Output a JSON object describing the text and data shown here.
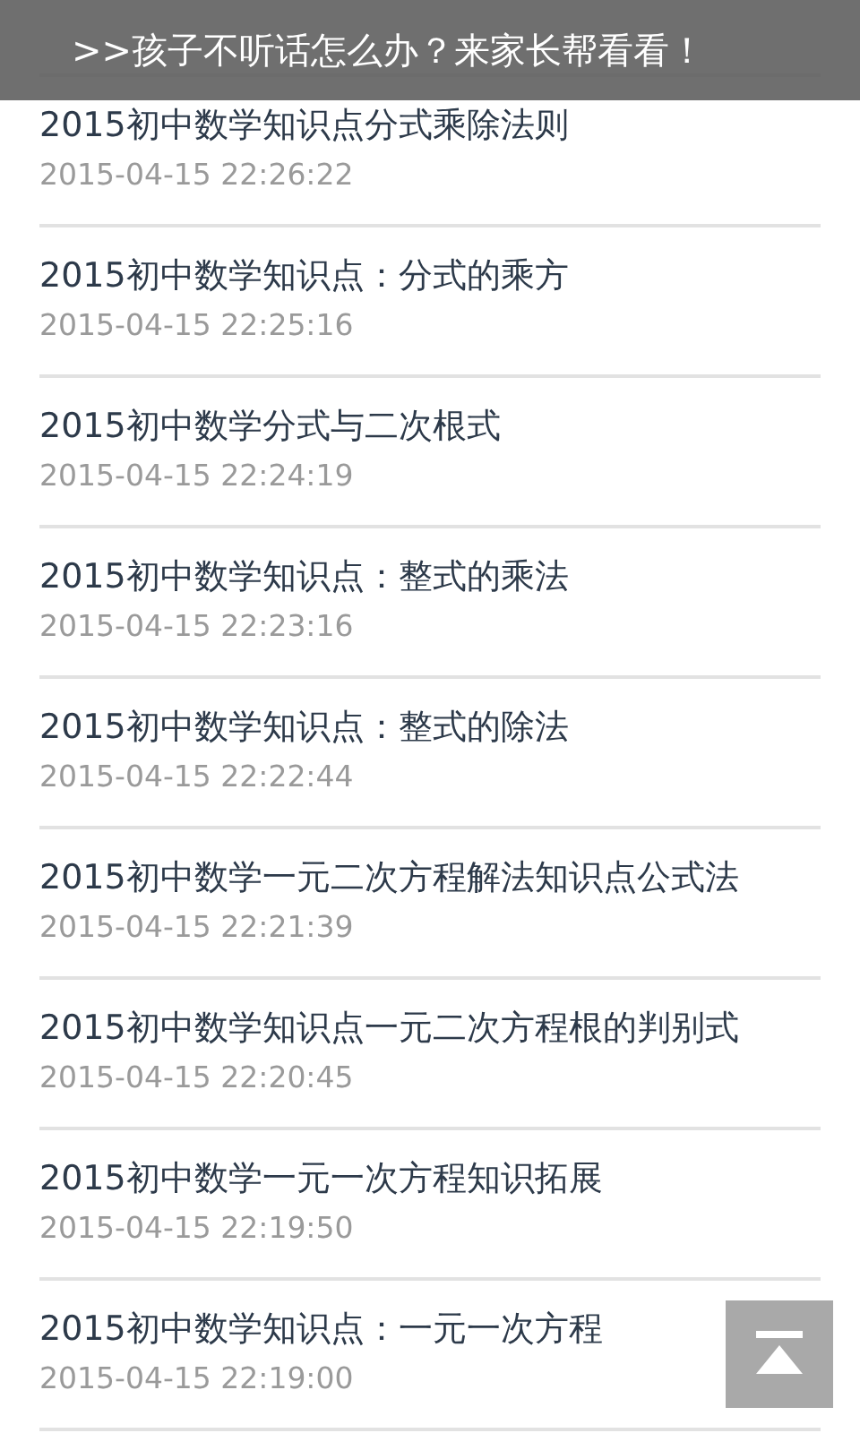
{
  "banner": {
    "text": ">>孩子不听话怎么办？来家长帮看看！"
  },
  "articles": [
    {
      "title": "2015初中数学知识点分式乘除法则",
      "date": "2015-04-15 22:26:22"
    },
    {
      "title": "2015初中数学知识点：分式的乘方",
      "date": "2015-04-15 22:25:16"
    },
    {
      "title": "2015初中数学分式与二次根式",
      "date": "2015-04-15 22:24:19"
    },
    {
      "title": "2015初中数学知识点：整式的乘法",
      "date": "2015-04-15 22:23:16"
    },
    {
      "title": "2015初中数学知识点：整式的除法",
      "date": "2015-04-15 22:22:44"
    },
    {
      "title": "2015初中数学一元二次方程解法知识点公式法",
      "date": "2015-04-15 22:21:39"
    },
    {
      "title": "2015初中数学知识点一元二次方程根的判别式",
      "date": "2015-04-15 22:20:45"
    },
    {
      "title": "2015初中数学一元一次方程知识拓展",
      "date": "2015-04-15 22:19:50"
    },
    {
      "title": "2015初中数学知识点：一元一次方程",
      "date": "2015-04-15 22:19:00"
    }
  ]
}
